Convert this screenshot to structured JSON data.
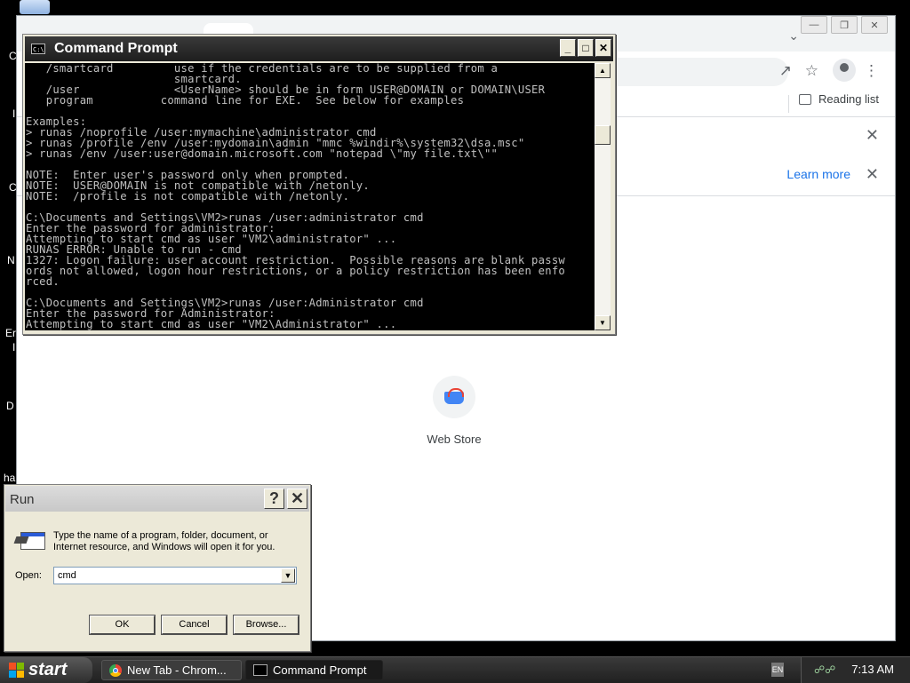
{
  "desktop": {
    "fragments": [
      "C",
      "I",
      "C",
      "N",
      "Er",
      "I",
      "D",
      "ha"
    ]
  },
  "chrome": {
    "bookmarks": {
      "reading_list": "Reading list"
    },
    "infobar2": {
      "learn_more": "Learn more"
    },
    "shortcut": {
      "label": "Web Store"
    }
  },
  "cmd": {
    "title": "Command Prompt",
    "console_text": "   /smartcard         use if the credentials are to be supplied from a\n                      smartcard.\n   /user              <UserName> should be in form USER@DOMAIN or DOMAIN\\USER\n   program          command line for EXE.  See below for examples\n\nExamples:\n> runas /noprofile /user:mymachine\\administrator cmd\n> runas /profile /env /user:mydomain\\admin \"mmc %windir%\\system32\\dsa.msc\"\n> runas /env /user:user@domain.microsoft.com \"notepad \\\"my file.txt\\\"\"\n\nNOTE:  Enter user's password only when prompted.\nNOTE:  USER@DOMAIN is not compatible with /netonly.\nNOTE:  /profile is not compatible with /netonly.\n\nC:\\Documents and Settings\\VM2>runas /user:administrator cmd\nEnter the password for administrator:\nAttempting to start cmd as user \"VM2\\administrator\" ...\nRUNAS ERROR: Unable to run - cmd\n1327: Logon failure: user account restriction.  Possible reasons are blank passw\nords not allowed, logon hour restrictions, or a policy restriction has been enfo\nrced.\n\nC:\\Documents and Settings\\VM2>runas /user:Administrator cmd\nEnter the password for Administrator:\nAttempting to start cmd as user \"VM2\\Administrator\" ..."
  },
  "run": {
    "title": "Run",
    "help": "?",
    "description": "Type the name of a program, folder, document, or Internet resource, and Windows will open it for you.",
    "open_label": "Open:",
    "open_value": "cmd",
    "ok": "OK",
    "cancel": "Cancel",
    "browse": "Browse..."
  },
  "taskbar": {
    "start": "start",
    "items": [
      {
        "label": "New Tab - Chrom...",
        "icon": "chrome-icon"
      },
      {
        "label": "Command Prompt",
        "icon": "cmd-icon"
      }
    ],
    "lang": "EN",
    "clock": "7:13 AM"
  }
}
